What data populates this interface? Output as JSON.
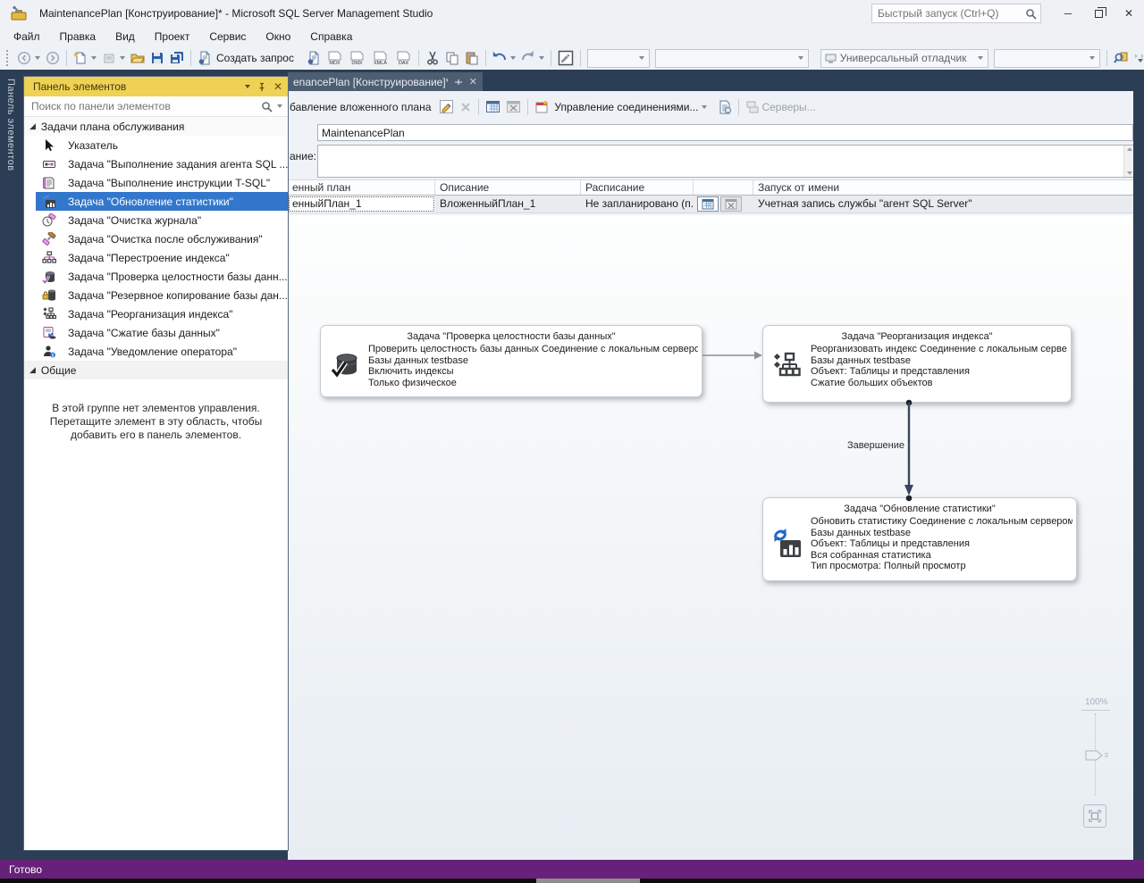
{
  "colors": {
    "status_bar": "#68217A",
    "selection": "#3377CC",
    "toolbox_header": "#EFD153",
    "frame": "#2C3E55"
  },
  "icons": {
    "group_expanded": "◢",
    "close": "✕",
    "minimize": "─"
  },
  "window": {
    "title": "MaintenancePlan [Конструирование]* - Microsoft SQL Server Management Studio",
    "quick_launch_placeholder": "Быстрый запуск (Ctrl+Q)"
  },
  "menu": {
    "items": [
      "Файл",
      "Правка",
      "Вид",
      "Проект",
      "Сервис",
      "Окно",
      "Справка"
    ]
  },
  "toolbar": {
    "new_query_label": "Создать запрос",
    "query_types": [
      "MDX",
      "DMX",
      "XMLA",
      "DAX"
    ],
    "debugger_label": "Универсальный отладчик"
  },
  "toolbox": {
    "vertical_tab_label": "Панель элементов",
    "title": "Панель элементов",
    "search_placeholder": "Поиск по панели элементов",
    "group1_label": "Задачи плана обслуживания",
    "items": [
      {
        "label": "Указатель"
      },
      {
        "label": "Задача \"Выполнение задания агента SQL ..."
      },
      {
        "label": "Задача \"Выполнение инструкции T-SQL\""
      },
      {
        "label": "Задача \"Обновление статистики\""
      },
      {
        "label": "Задача \"Очистка журнала\""
      },
      {
        "label": "Задача \"Очистка после обслуживания\""
      },
      {
        "label": "Задача \"Перестроение индекса\""
      },
      {
        "label": "Задача \"Проверка целостности базы данн..."
      },
      {
        "label": "Задача \"Резервное копирование базы дан..."
      },
      {
        "label": "Задача \"Реорганизация индекса\""
      },
      {
        "label": "Задача \"Сжатие базы данных\""
      },
      {
        "label": "Задача \"Уведомление оператора\""
      }
    ],
    "group2_label": "Общие",
    "group2_hint": "В этой группе нет элементов управления. Перетащите элемент в эту область, чтобы добавить его в панель элементов."
  },
  "document": {
    "tab_title": "enancePlan [Конструирование]*",
    "toolbar": {
      "add_subplan_label": "бавление вложенного плана",
      "manage_connections_label": "Управление соединениями...",
      "servers_label": "Серверы..."
    },
    "name_value": "MaintenancePlan",
    "description_label": "ание:",
    "grid": {
      "columns": [
        "енный план",
        "Описание",
        "Расписание",
        "",
        "Запуск от имени"
      ],
      "row": {
        "plan": "енныйПлан_1",
        "description": "ВложенныйПлан_1",
        "schedule": "Не запланировано (п...",
        "run_as": "Учетная запись службы \"агент SQL Server\""
      }
    },
    "designer": {
      "tasks": [
        {
          "title": "Задача \"Проверка целостности базы данных\"",
          "lines": [
            "Проверить целостность базы данных Соединение с локальным сервером",
            "Базы данных testbase",
            "Включить индексы",
            "Только физическое"
          ]
        },
        {
          "title": "Задача \"Реорганизация индекса\"",
          "lines": [
            "Реорганизовать индекс Соединение с локальным сервер",
            "Базы данных testbase",
            "Объект: Таблицы и представления",
            "Сжатие больших объектов"
          ]
        },
        {
          "title": "Задача \"Обновление статистики\"",
          "lines": [
            "Обновить статистику Соединение с локальным сервером",
            "Базы данных testbase",
            "Объект: Таблицы и представления",
            "Вся собранная статистика",
            "Тип просмотра: Полный просмотр"
          ]
        }
      ],
      "connector_label": "Завершение",
      "zoom_level": "100%"
    }
  },
  "status_bar": {
    "text": "Готово"
  }
}
